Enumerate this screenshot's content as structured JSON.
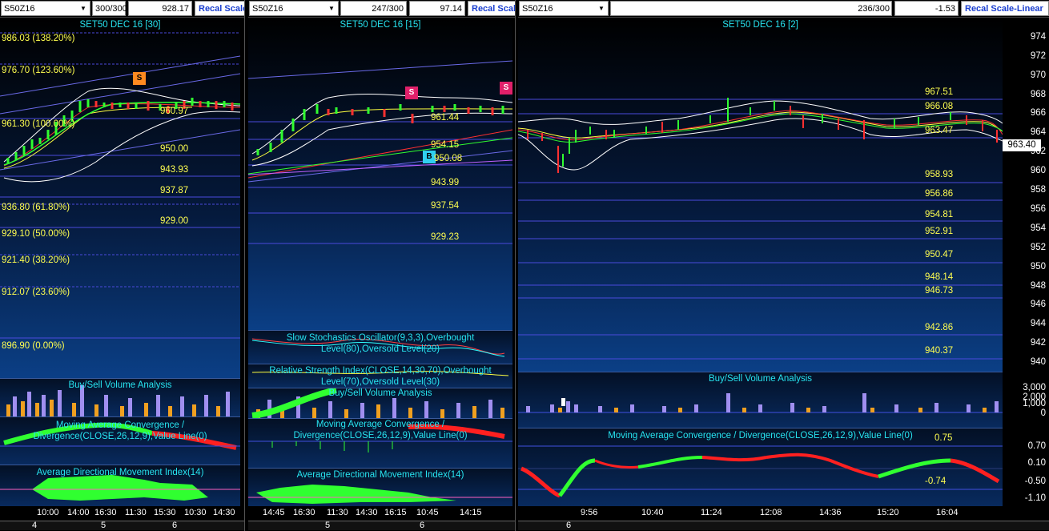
{
  "panels": [
    {
      "symbol": "S50Z16",
      "count": "300/300",
      "price": "928.17",
      "recal": "Recal Scale",
      "title": "SET50 DEC 16  [30]",
      "fib": [
        "986.03 (138.20%)",
        "976.70 (123.60%)",
        "961.30 (100.00%)",
        "936.80 (61.80%)",
        "929.10 (50.00%)",
        "921.40 (38.20%)",
        "912.07 (23.60%)",
        "896.90 (0.00%)"
      ],
      "levels": [
        "960.97",
        "950.00",
        "943.93",
        "937.87",
        "929.00"
      ],
      "signal": "S",
      "vol_title": "Buy/Sell Volume Analysis",
      "macd_title": "Moving Average Convergence / Divergence(CLOSE,26,12,9),Value Line(0)",
      "adx_title": "Average Directional Movement Index(14)",
      "times": [
        "10:00",
        "14:00",
        "16:30",
        "11:30",
        "15:30",
        "10:30",
        "14:30"
      ],
      "days": [
        "4",
        "5",
        "6"
      ]
    },
    {
      "symbol": "S50Z16",
      "count": "247/300",
      "price": "97.14",
      "recal": "Recal Scale",
      "title": "SET50 DEC 16  [15]",
      "levels": [
        "961.44",
        "954.15",
        "950.08",
        "943.99",
        "937.54",
        "929.23"
      ],
      "signal_s": "S",
      "signal_b": "B",
      "stoch_title": "Slow Stochastics Oscillator(9,3,3),Overbought Level(80),Oversold Level(20)",
      "rsi_title": "Relative Strength Index(CLOSE,14,30,70),Overbought Level(70),Oversold Level(30)",
      "vol_title": "Buy/Sell Volume Analysis",
      "macd_title": "Moving Average Convergence / Divergence(CLOSE,26,12,9),Value Line(0)",
      "adx_title": "Average Directional Movement Index(14)",
      "times": [
        "14:45",
        "16:30",
        "11:30",
        "14:30",
        "16:15",
        "10:45",
        "14:15"
      ],
      "days": [
        "5",
        "6"
      ]
    },
    {
      "symbol": "S50Z16",
      "count": "236/300",
      "price": "-1.53",
      "recal": "Recal Scale-Linear",
      "title": "SET50 DEC 16  [2]",
      "levels": [
        "967.51",
        "966.08",
        "963.47",
        "958.93",
        "956.86",
        "954.81",
        "952.91",
        "950.47",
        "948.14",
        "946.73",
        "942.86",
        "940.37"
      ],
      "last_price": "963.40",
      "yticks": [
        "974",
        "972",
        "970",
        "968",
        "966",
        "964",
        "962",
        "960",
        "958",
        "956",
        "954",
        "952",
        "950",
        "948",
        "946",
        "944",
        "942",
        "940"
      ],
      "vol_title": "Buy/Sell Volume Analysis",
      "vol_ticks": [
        "3,000",
        "2,000",
        "1,000",
        "0"
      ],
      "macd_title": "Moving Average Convergence / Divergence(CLOSE,26,12,9),Value Line(0)",
      "macd_hi": "0.75",
      "macd_lo": "-0.74",
      "macd_ticks": [
        "0.70",
        "0.10",
        "-0.50",
        "-1.10"
      ],
      "times": [
        "9:56",
        "10:40",
        "11:24",
        "12:08",
        "14:36",
        "15:20",
        "16:04"
      ],
      "days": [
        "6"
      ]
    }
  ],
  "colors": {
    "title": "#27e4f0",
    "level": "#ffff50",
    "bullish": "#20ff20",
    "bearish": "#ff2020",
    "recal": "#1a3fd0"
  }
}
